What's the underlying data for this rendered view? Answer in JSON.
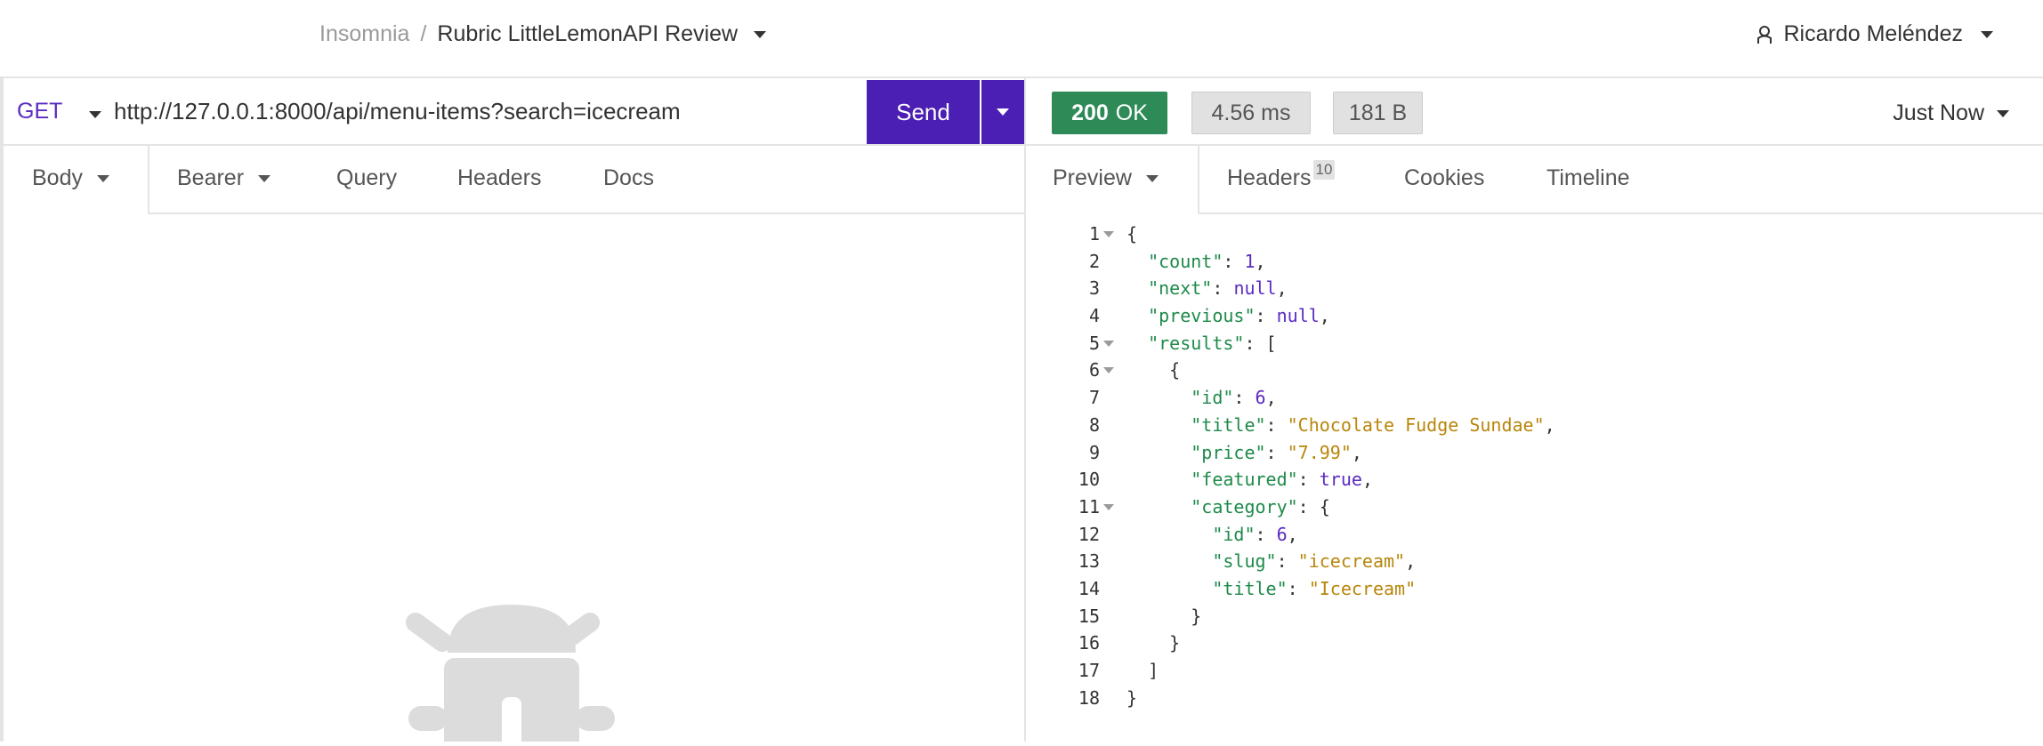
{
  "breadcrumb": {
    "app": "Insomnia",
    "separator": "/",
    "project": "Rubric LittleLemonAPI Review"
  },
  "user": {
    "name": "Ricardo Meléndez"
  },
  "request": {
    "method": "GET",
    "url": "http://127.0.0.1:8000/api/menu-items?search=icecream",
    "send_label": "Send",
    "tabs": [
      {
        "label": "Body",
        "dropdown": true
      },
      {
        "label": "Bearer",
        "dropdown": true
      },
      {
        "label": "Query"
      },
      {
        "label": "Headers"
      },
      {
        "label": "Docs"
      }
    ]
  },
  "response": {
    "status_code": "200",
    "status_text": "OK",
    "time": "4.56 ms",
    "size": "181 B",
    "received": "Just Now",
    "tabs": [
      {
        "label": "Preview",
        "dropdown": true
      },
      {
        "label": "Headers",
        "badge": "10"
      },
      {
        "label": "Cookies"
      },
      {
        "label": "Timeline"
      }
    ]
  },
  "colors": {
    "accent": "#4b1fb3",
    "status_ok": "#2e8b57",
    "json_key": "#1e8a4a",
    "json_string": "#b8860b",
    "json_literal": "#5b2bc2"
  },
  "icons": {
    "user": "user-icon",
    "bug": "bug-icon"
  },
  "code_lines": [
    {
      "n": "1",
      "fold": true,
      "html": "{"
    },
    {
      "n": "2",
      "html": "  <span class=\"k\">\"count\"</span>: <span class=\"n\">1</span>,"
    },
    {
      "n": "3",
      "html": "  <span class=\"k\">\"next\"</span>: <span class=\"kw\">null</span>,"
    },
    {
      "n": "4",
      "html": "  <span class=\"k\">\"previous\"</span>: <span class=\"kw\">null</span>,"
    },
    {
      "n": "5",
      "fold": true,
      "html": "  <span class=\"k\">\"results\"</span>: ["
    },
    {
      "n": "6",
      "fold": true,
      "html": "    {"
    },
    {
      "n": "7",
      "html": "      <span class=\"k\">\"id\"</span>: <span class=\"n\">6</span>,"
    },
    {
      "n": "8",
      "html": "      <span class=\"k\">\"title\"</span>: <span class=\"s\">\"Chocolate Fudge Sundae\"</span>,"
    },
    {
      "n": "9",
      "html": "      <span class=\"k\">\"price\"</span>: <span class=\"s\">\"7.99\"</span>,"
    },
    {
      "n": "10",
      "html": "      <span class=\"k\">\"featured\"</span>: <span class=\"kw\">true</span>,"
    },
    {
      "n": "11",
      "fold": true,
      "html": "      <span class=\"k\">\"category\"</span>: {"
    },
    {
      "n": "12",
      "html": "        <span class=\"k\">\"id\"</span>: <span class=\"n\">6</span>,"
    },
    {
      "n": "13",
      "html": "        <span class=\"k\">\"slug\"</span>: <span class=\"s\">\"icecream\"</span>,"
    },
    {
      "n": "14",
      "html": "        <span class=\"k\">\"title\"</span>: <span class=\"s\">\"Icecream\"</span>"
    },
    {
      "n": "15",
      "html": "      }"
    },
    {
      "n": "16",
      "html": "    }"
    },
    {
      "n": "17",
      "html": "  ]"
    },
    {
      "n": "18",
      "html": "}"
    }
  ]
}
